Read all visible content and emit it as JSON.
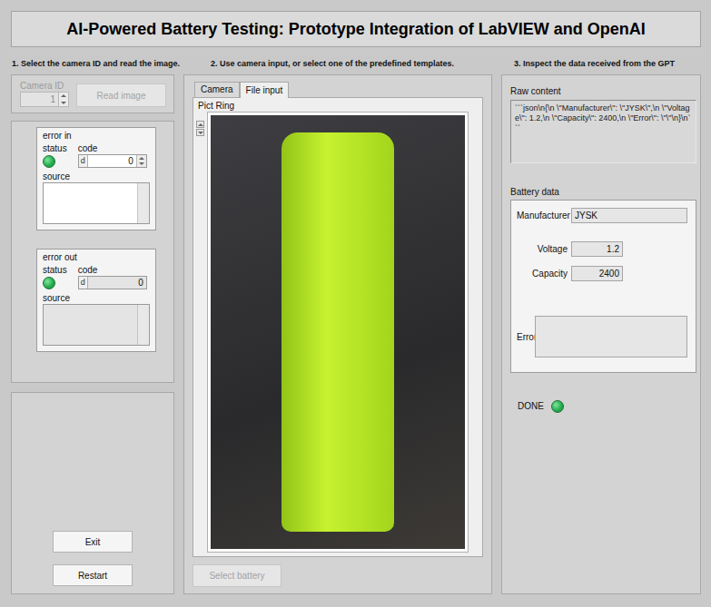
{
  "window": {
    "title": "AI-Powered Battery Testing: Prototype Integration of LabVIEW and OpenAI"
  },
  "steps": [
    "1. Select the camera ID and read the image.",
    "2. Use camera input, or select one of the predefined templates.",
    "3. Inspect the data received from the GPT"
  ],
  "camera": {
    "label": "Camera ID",
    "value": "1",
    "disabled": true,
    "button": {
      "label": "Read image",
      "disabled": true
    }
  },
  "errorClusters": [
    {
      "title": "error in",
      "statusLabel": "status",
      "ok": true,
      "codeLabel": "code",
      "radix": "d",
      "code": "0",
      "sourceLabel": "source",
      "source": "",
      "kind": "control"
    },
    {
      "title": "error out",
      "statusLabel": "status",
      "ok": true,
      "codeLabel": "code",
      "radix": "d",
      "code": "0",
      "sourceLabel": "source",
      "source": "",
      "kind": "indicator"
    }
  ],
  "controls": [
    {
      "label": "Exit",
      "disabled": false
    },
    {
      "label": "Restart",
      "disabled": false
    }
  ],
  "tabs": [
    {
      "label": "Camera",
      "selected": false
    },
    {
      "label": "File input",
      "selected": true
    }
  ],
  "pictRing": {
    "label": "Pict Ring"
  },
  "selectButton": {
    "label": "Select battery",
    "disabled": true
  },
  "raw": {
    "label": "Raw content",
    "value": "```json\\n{\\n \\\"Manufacturer\\\": \\\"JYSK\\\",\\n \\\"Voltage\\\": 1.2,\\n \\\"Capacity\\\": 2400,\\n \\\"Error\\\": \\\"\\\"\\n}\\n```"
  },
  "battery": {
    "title": "Battery data",
    "fields": [
      {
        "label": "Manufacturer",
        "value": "JYSK",
        "kind": "text"
      },
      {
        "label": "Voltage",
        "value": "1.2",
        "kind": "number"
      },
      {
        "label": "Capacity",
        "value": "2400",
        "kind": "number"
      },
      {
        "label": "Error",
        "value": "",
        "kind": "area"
      }
    ]
  },
  "done": {
    "label": "DONE",
    "on": true
  }
}
